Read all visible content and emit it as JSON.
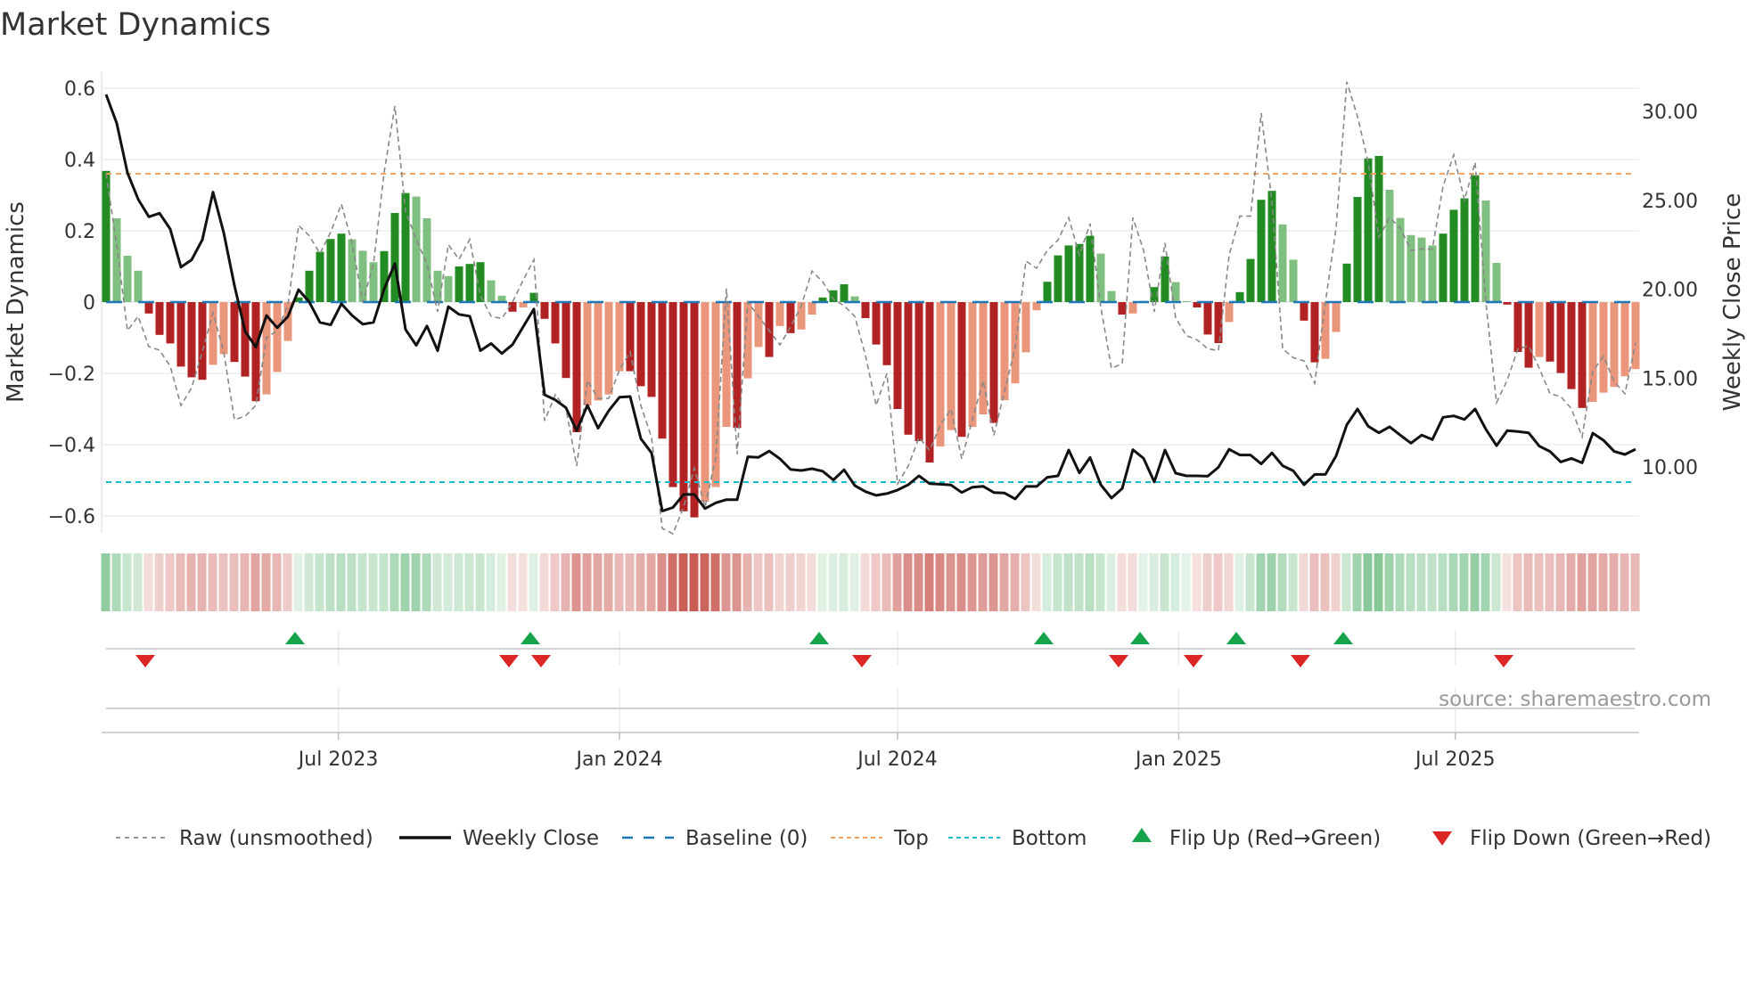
{
  "chart_data": {
    "type": "bar",
    "title": "Market Dynamics",
    "ylabel": "Market Dynamics",
    "ylabel_right": "Weekly Close Price",
    "source": "source: sharemaestro.com",
    "start_date": "2023-01-30",
    "frequency": "weekly",
    "ylim": [
      -0.65,
      0.65
    ],
    "yticks": [
      0.6,
      0.4,
      0.2,
      0,
      -0.2,
      -0.4,
      -0.6
    ],
    "ytick_labels": [
      "0.6",
      "0.4",
      "0.2",
      "0",
      "−0.2",
      "−0.4",
      "−0.6"
    ],
    "yticks_right": [
      30,
      25,
      20,
      15,
      10
    ],
    "ytick_right_labels": [
      "30.00",
      "25.00",
      "20.00",
      "15.00",
      "10.00"
    ],
    "xticks": [
      {
        "date": "2023-07-01",
        "label": "Jul 2023"
      },
      {
        "date": "2024-01-01",
        "label": "Jan 2024"
      },
      {
        "date": "2024-07-01",
        "label": "Jul 2024"
      },
      {
        "date": "2025-01-01",
        "label": "Jan 2025"
      },
      {
        "date": "2025-07-01",
        "label": "Jul 2025"
      }
    ],
    "baseline": 0,
    "top": 0.36,
    "bottom": -0.505,
    "grid": true,
    "legend_position": "bottom",
    "colors": {
      "green_strong": "#228b22",
      "green_weak": "#7fbf7f",
      "red_strong": "#b22222",
      "red_weak": "#e9967a",
      "raw": "#888888",
      "close": "#111111",
      "baseline": "#1f77b4",
      "top": "#f4a460",
      "bottom": "#17becf",
      "flip_up": "#16a34a",
      "flip_down": "#dc2626"
    },
    "series": [
      {
        "name": "Market Dynamics",
        "values": [
          0.368,
          0.235,
          0.13,
          0.088,
          -0.032,
          -0.092,
          -0.116,
          -0.181,
          -0.211,
          -0.218,
          -0.176,
          -0.146,
          -0.168,
          -0.209,
          -0.278,
          -0.259,
          -0.196,
          -0.109,
          0.013,
          0.088,
          0.141,
          0.177,
          0.192,
          0.176,
          0.144,
          0.112,
          0.143,
          0.25,
          0.306,
          0.296,
          0.235,
          0.088,
          0.073,
          0.1,
          0.107,
          0.112,
          0.061,
          0.018,
          -0.027,
          -0.015,
          0.026,
          -0.047,
          -0.116,
          -0.213,
          -0.365,
          -0.29,
          -0.276,
          -0.259,
          -0.194,
          -0.194,
          -0.236,
          -0.266,
          -0.383,
          -0.519,
          -0.587,
          -0.604,
          -0.56,
          -0.519,
          -0.35,
          -0.353,
          -0.214,
          -0.126,
          -0.154,
          -0.067,
          -0.087,
          -0.077,
          -0.035,
          0.013,
          0.033,
          0.05,
          0.016,
          -0.045,
          -0.119,
          -0.177,
          -0.3,
          -0.372,
          -0.39,
          -0.45,
          -0.405,
          -0.359,
          -0.378,
          -0.35,
          -0.315,
          -0.339,
          -0.275,
          -0.228,
          -0.141,
          -0.023,
          0.057,
          0.131,
          0.159,
          0.163,
          0.186,
          0.136,
          0.031,
          -0.035,
          -0.032,
          0.003,
          0.042,
          0.128,
          0.056,
          0.003,
          -0.015,
          -0.091,
          -0.115,
          -0.056,
          0.028,
          0.121,
          0.287,
          0.312,
          0.218,
          0.119,
          -0.052,
          -0.169,
          -0.159,
          -0.084,
          0.108,
          0.295,
          0.403,
          0.41,
          0.315,
          0.236,
          0.188,
          0.181,
          0.159,
          0.192,
          0.259,
          0.291,
          0.356,
          0.285,
          0.11,
          -0.007,
          -0.14,
          -0.184,
          -0.154,
          -0.167,
          -0.199,
          -0.244,
          -0.297,
          -0.28,
          -0.254,
          -0.238,
          -0.208,
          -0.188
        ]
      },
      {
        "name": "Raw (unsmoothed)",
        "values": [
          0.36,
          0.16,
          -0.08,
          -0.04,
          -0.125,
          -0.135,
          -0.18,
          -0.29,
          -0.24,
          -0.14,
          -0.03,
          -0.14,
          -0.33,
          -0.32,
          -0.29,
          -0.1,
          -0.08,
          -0.01,
          0.215,
          0.186,
          0.136,
          0.196,
          0.275,
          0.166,
          0,
          0.107,
          0.364,
          0.55,
          0.255,
          0.176,
          0.107,
          -0.027,
          0.161,
          0.12,
          0.176,
          0.018,
          -0.04,
          -0.046,
          0,
          0.062,
          0.119,
          -0.333,
          -0.26,
          -0.3,
          -0.46,
          -0.22,
          -0.27,
          -0.27,
          -0.19,
          -0.14,
          -0.29,
          -0.38,
          -0.635,
          -0.65,
          -0.575,
          -0.466,
          -0.575,
          -0.437,
          0.038,
          -0.427,
          0,
          -0.04,
          -0.08,
          -0.12,
          -0.07,
          -0.01,
          0.087,
          0.057,
          0.008,
          -0.01,
          -0.04,
          -0.15,
          -0.29,
          -0.2,
          -0.51,
          -0.46,
          -0.38,
          -0.416,
          -0.345,
          -0.3,
          -0.44,
          -0.33,
          -0.22,
          -0.374,
          -0.25,
          -0.127,
          0.115,
          0.095,
          0.145,
          0.174,
          0.237,
          0.132,
          0.22,
          -0.014,
          -0.186,
          -0.173,
          0.237,
          0.145,
          -0.027,
          0.166,
          -0.044,
          -0.094,
          -0.106,
          -0.131,
          -0.136,
          0.132,
          0.241,
          0.241,
          0.53,
          0.283,
          -0.131,
          -0.156,
          -0.165,
          -0.228,
          0,
          0.208,
          0.618,
          0.521,
          0.392,
          0.182,
          0.237,
          0.208,
          0.145,
          0.149,
          0.149,
          0.325,
          0.413,
          0.287,
          0.392,
          0,
          -0.282,
          -0.219,
          -0.131,
          -0.123,
          -0.186,
          -0.257,
          -0.265,
          -0.299,
          -0.378,
          -0.194,
          -0.152,
          -0.223,
          -0.257,
          -0.115
        ]
      },
      {
        "name": "Weekly Close",
        "axis": "right",
        "values": [
          30.95,
          29.33,
          26.55,
          25.06,
          24.07,
          24.27,
          23.38,
          21.24,
          21.65,
          22.78,
          25.46,
          23.18,
          20.21,
          17.63,
          16.74,
          18.52,
          17.83,
          18.46,
          19.97,
          19.28,
          18.13,
          17.99,
          19.18,
          18.52,
          18.03,
          18.13,
          20.01,
          21.44,
          17.73,
          16.84,
          17.93,
          16.54,
          19.02,
          18.58,
          18.48,
          16.54,
          16.94,
          16.38,
          16.88,
          17.89,
          18.88,
          14.06,
          13.77,
          13.33,
          12.04,
          13.47,
          12.18,
          13.17,
          13.92,
          13.96,
          11.59,
          10.79,
          7.52,
          7.72,
          8.45,
          8.45,
          7.66,
          7.98,
          8.16,
          8.16,
          10.57,
          10.54,
          10.89,
          10.46,
          9.86,
          9.8,
          9.9,
          9.76,
          9.27,
          9.84,
          8.95,
          8.61,
          8.4,
          8.5,
          8.7,
          9.0,
          9.5,
          9.06,
          9.03,
          8.98,
          8.56,
          8.86,
          8.91,
          8.56,
          8.53,
          8.2,
          8.9,
          8.9,
          9.42,
          9.5,
          10.95,
          9.67,
          10.53,
          9.0,
          8.25,
          8.78,
          10.97,
          10.48,
          9.16,
          10.95,
          9.65,
          9.5,
          9.5,
          9.48,
          9.98,
          10.99,
          10.67,
          10.67,
          10.17,
          10.79,
          10.07,
          9.78,
          9.0,
          9.58,
          9.58,
          10.62,
          12.37,
          13.26,
          12.29,
          11.92,
          12.26,
          11.79,
          11.34,
          11.79,
          11.54,
          12.79,
          12.87,
          12.67,
          13.26,
          12.12,
          11.2,
          12.04,
          11.99,
          11.92,
          11.17,
          10.87,
          10.28,
          10.48,
          10.23,
          11.9,
          11.5,
          10.87,
          10.7,
          11.0
        ]
      }
    ],
    "flip_up_weeks": [
      18,
      40,
      67,
      88,
      97,
      106,
      116
    ],
    "flip_down_weeks": [
      4,
      38,
      41,
      71,
      95,
      102,
      112,
      131
    ],
    "legend": [
      {
        "key": "raw",
        "label": "Raw (unsmoothed)"
      },
      {
        "key": "close",
        "label": "Weekly Close"
      },
      {
        "key": "baseline",
        "label": "Baseline (0)"
      },
      {
        "key": "top",
        "label": "Top"
      },
      {
        "key": "bottom",
        "label": "Bottom"
      },
      {
        "key": "flip_up",
        "label": "Flip Up (Red→Green)"
      },
      {
        "key": "flip_down",
        "label": "Flip Down (Green→Red)"
      }
    ]
  }
}
